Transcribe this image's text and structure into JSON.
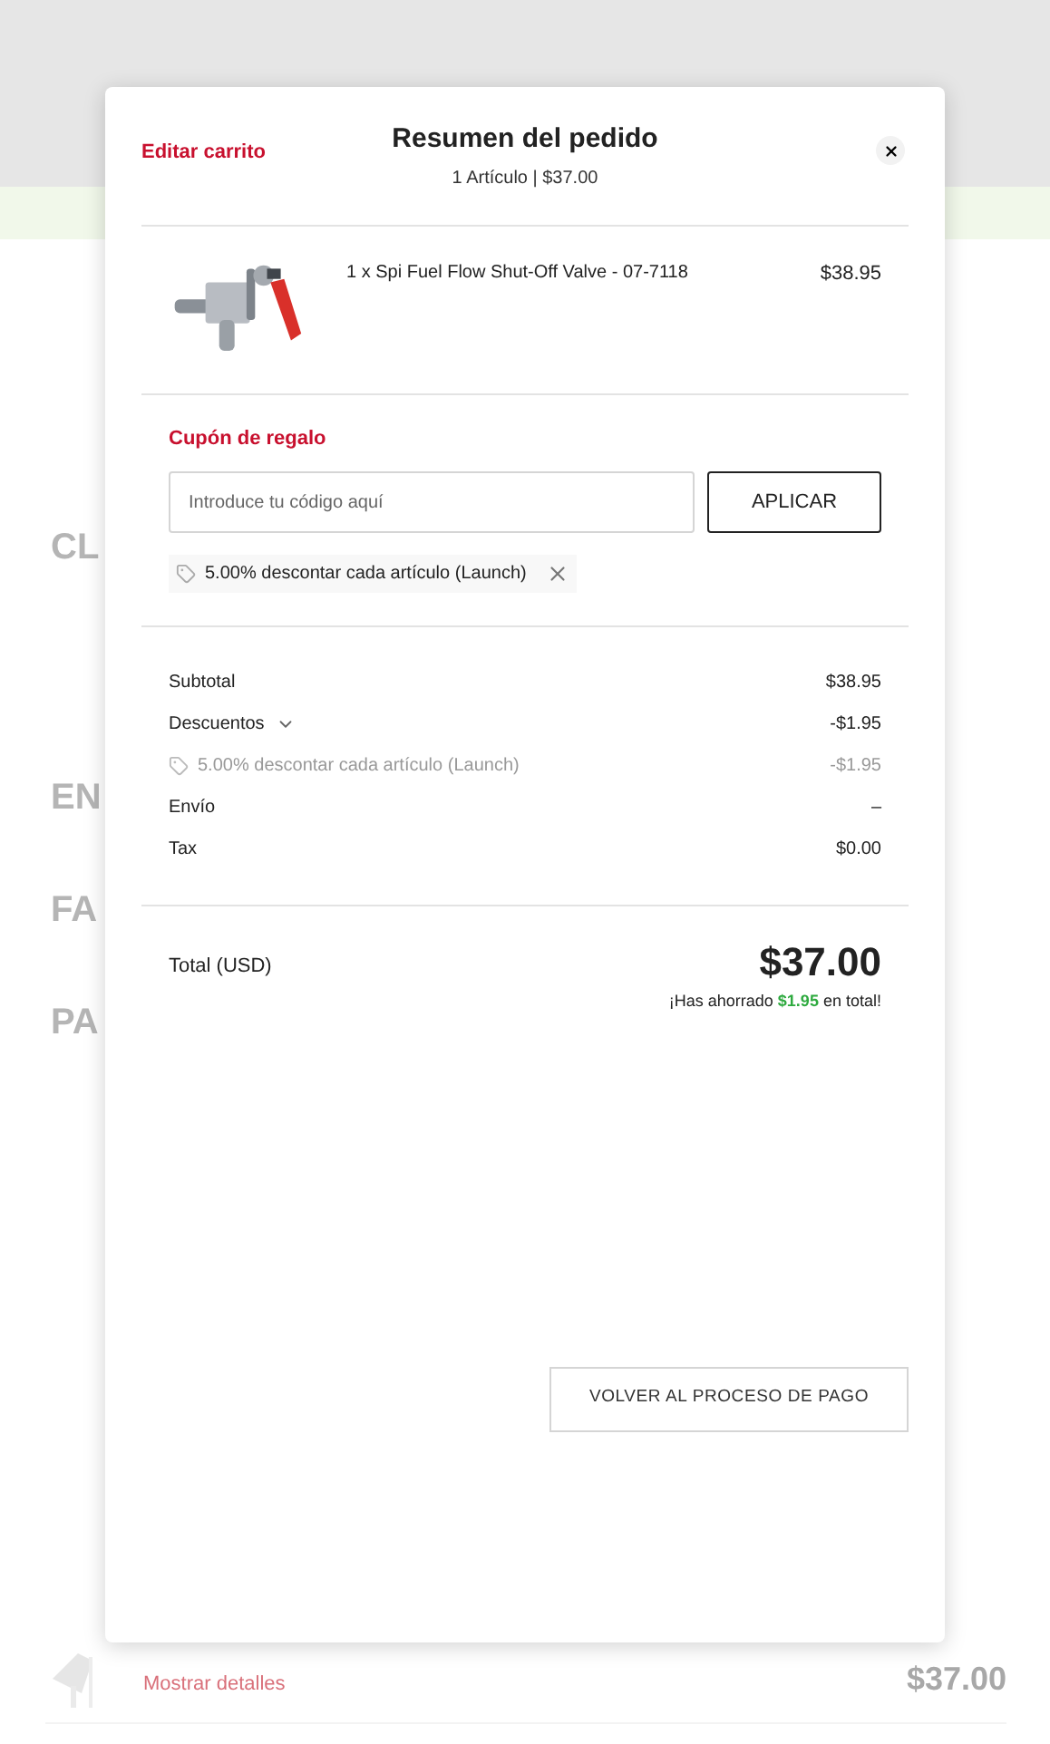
{
  "background": {
    "section_headings": [
      "CL",
      "EN",
      "FA",
      "PA"
    ],
    "footer": {
      "link": "Mostrar detalles",
      "total": "$37.00"
    }
  },
  "modal": {
    "edit_link": "Editar carrito",
    "title": "Resumen del pedido",
    "subtitle": "1 Artículo | $37.00",
    "items": [
      {
        "name": "1 x Spi Fuel Flow Shut-Off Valve - 07-7118",
        "price": "$38.95"
      }
    ],
    "coupon": {
      "title": "Cupón de regalo",
      "placeholder": "Introduce tu código aquí",
      "button": "APLICAR",
      "applied": [
        {
          "label": "5.00% descontar cada artículo (Launch)"
        }
      ]
    },
    "summary": [
      {
        "kind": "plain",
        "label": "Subtotal",
        "value": "$38.95"
      },
      {
        "kind": "expandable",
        "label": "Descuentos",
        "value": "-$1.95",
        "expanded": true
      },
      {
        "kind": "detail",
        "label": "5.00% descontar cada artículo (Launch)",
        "value": "-$1.95"
      },
      {
        "kind": "plain",
        "label": "Envío",
        "value": "–"
      },
      {
        "kind": "plain",
        "label": "Tax",
        "value": "$0.00"
      }
    ],
    "total": {
      "label": "Total (USD)",
      "amount": "$37.00",
      "saved": {
        "before": "¡Has ahorrado",
        "amount": "$1.95",
        "after": "en total!"
      }
    },
    "back_button": "VOLVER AL PROCESO DE PAGO"
  }
}
